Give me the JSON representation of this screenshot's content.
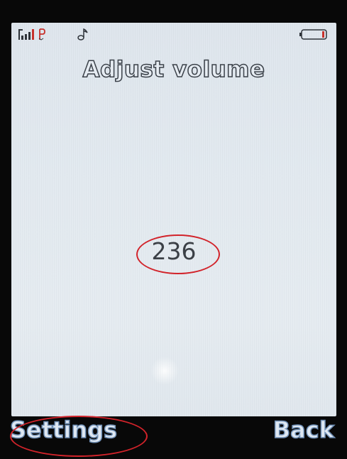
{
  "status_bar": {
    "signal_icon": "signal-strength-icon",
    "gprs_icon": "gprs-icon",
    "gprs_label": "P",
    "ringtone_icon": "music-note-icon",
    "battery_icon": "battery-icon"
  },
  "screen": {
    "title": "Adjust volume",
    "value": "236"
  },
  "softkeys": {
    "left_label": "Settings",
    "right_label": "Back"
  },
  "colors": {
    "annotation": "#d2232a",
    "screen_bg": "#e3eaf0",
    "softkey_text": "#dfe8f2",
    "signal_accent": "#c8302a"
  }
}
